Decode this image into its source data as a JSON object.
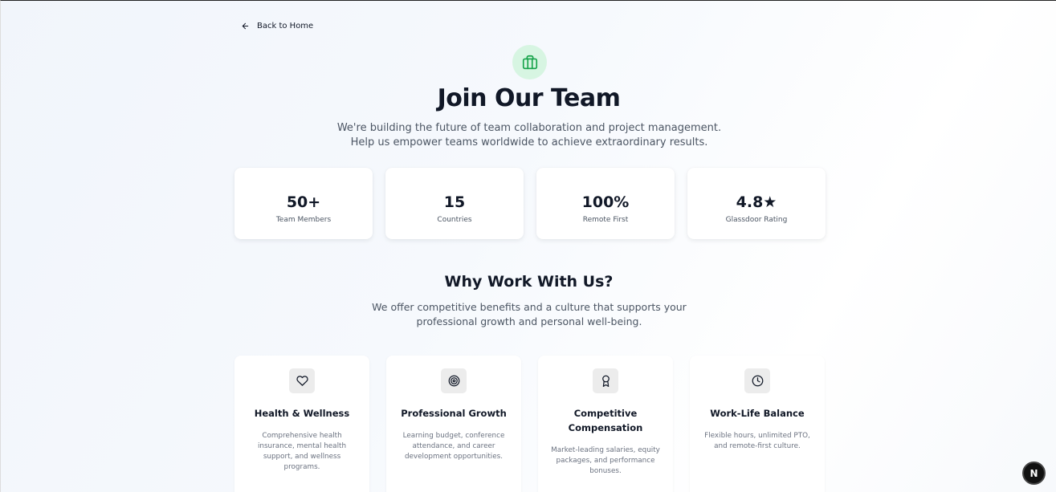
{
  "nav": {
    "back_label": "Back to Home"
  },
  "hero": {
    "icon": "briefcase-icon",
    "accent_color": "#16a34a",
    "title": "Join Our Team",
    "subtitle": "We're building the future of team collaboration and project management. Help us empower teams worldwide to achieve extraordinary results."
  },
  "stats": [
    {
      "value": "50+",
      "label": "Team Members"
    },
    {
      "value": "15",
      "label": "Countries"
    },
    {
      "value": "100%",
      "label": "Remote First"
    },
    {
      "value": "4.8★",
      "label": "Glassdoor Rating"
    }
  ],
  "why": {
    "title": "Why Work With Us?",
    "subtitle": "We offer competitive benefits and a culture that supports your professional growth and personal well-being."
  },
  "benefits": [
    {
      "icon": "heart-icon",
      "title": "Health & Wellness",
      "description": "Comprehensive health insurance, mental health support, and wellness programs."
    },
    {
      "icon": "target-icon",
      "title": "Professional Growth",
      "description": "Learning budget, conference attendance, and career development opportunities."
    },
    {
      "icon": "award-icon",
      "title": "Competitive Compensation",
      "description": "Market-leading salaries, equity packages, and performance bonuses."
    },
    {
      "icon": "clock-icon",
      "title": "Work-Life Balance",
      "description": "Flexible hours, unlimited PTO, and remote-first culture."
    }
  ],
  "dev_badge": {
    "label": "N"
  }
}
